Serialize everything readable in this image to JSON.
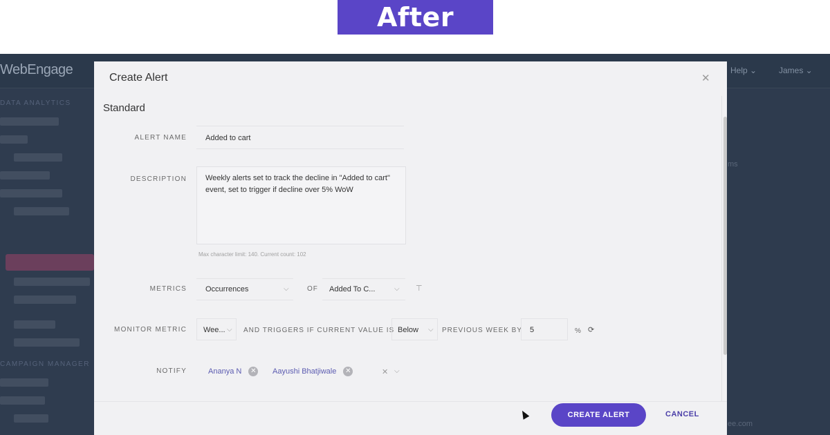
{
  "banner": {
    "label": "After"
  },
  "app": {
    "logo": "WebEngage",
    "help_label": "Help",
    "user_label": "James",
    "background_hint": "ms",
    "background_hint2": "ee.com",
    "sidebar_headings": [
      "DATA ANALYTICS",
      "CAMPAIGN MANAGER"
    ]
  },
  "modal": {
    "title": "Create Alert",
    "section": "Standard",
    "fields": {
      "alert_name_label": "ALERT NAME",
      "alert_name_value": "Added to cart",
      "description_label": "DESCRIPTION",
      "description_value": "Weekly alerts set to track the decline in \"Added to cart\" event, set to trigger if decline over 5% WoW",
      "description_hint": "Max character limit: 140. Current count: 102",
      "metrics_label": "METRICS",
      "metrics_value": "Occurrences",
      "of_label": "OF",
      "event_value": "Added To C...",
      "monitor_label": "MONITOR METRIC",
      "monitor_value": "Wee...",
      "triggers_label": "AND TRIGGERS IF CURRENT VALUE IS",
      "direction_value": "Below",
      "previous_label": "PREVIOUS WEEK BY",
      "threshold_value": "5",
      "unit": "%",
      "notify_label": "NOTIFY",
      "notify_recipients": [
        "Ananya N",
        "Aayushi Bhatjiwale"
      ]
    },
    "buttons": {
      "create": "CREATE ALERT",
      "cancel": "CANCEL"
    }
  }
}
